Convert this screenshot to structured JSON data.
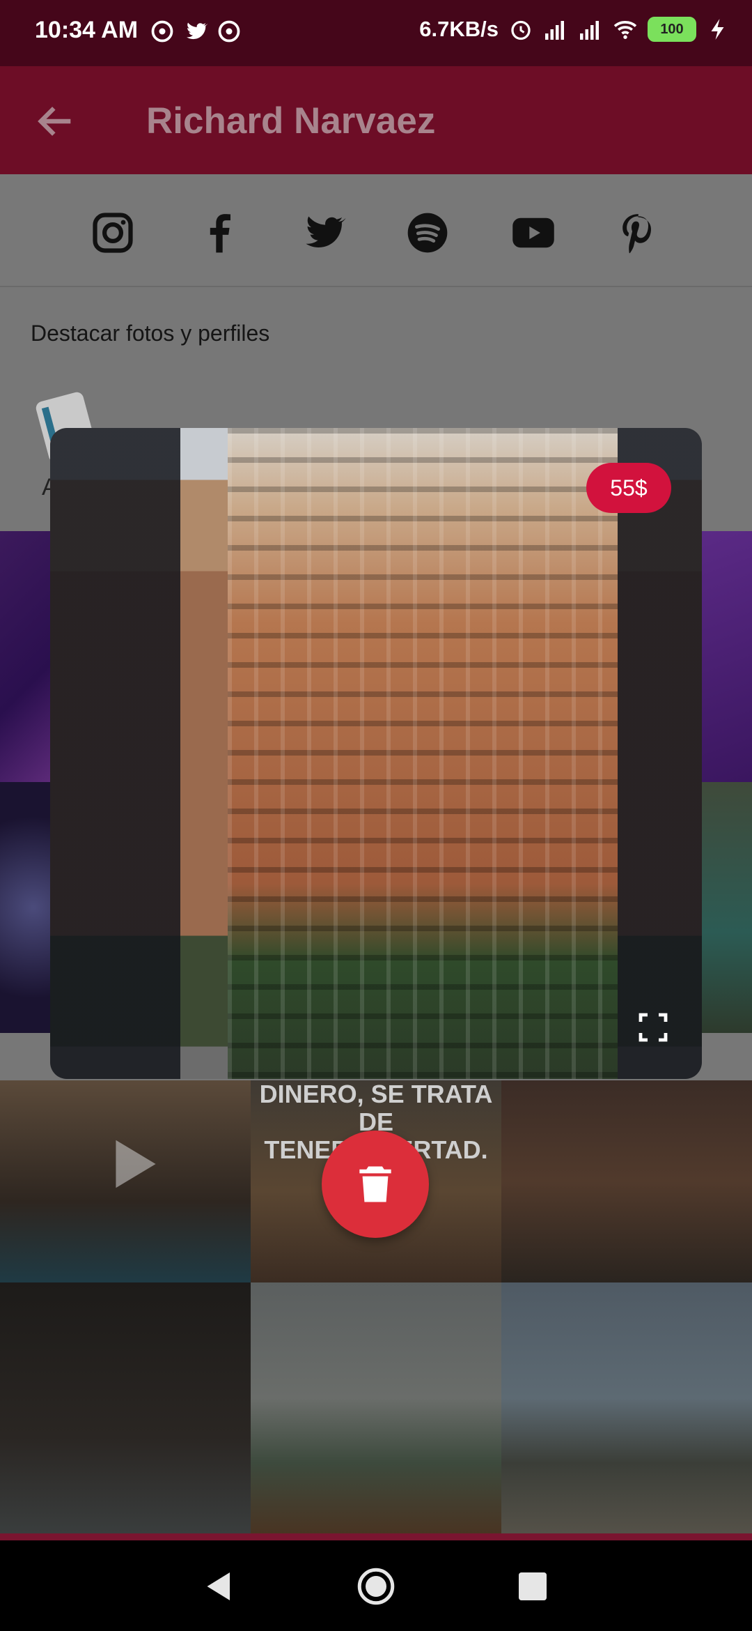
{
  "status_bar": {
    "time": "10:34 AM",
    "speed": "6.7KB/s",
    "battery": "100",
    "icons": [
      "sync-icon",
      "twitter-icon",
      "sync-icon",
      "alarm-icon",
      "signal-icon",
      "signal-icon",
      "wifi-icon",
      "battery-icon",
      "charging-icon"
    ]
  },
  "app_bar": {
    "title": "Richard Narvaez",
    "back_icon": "back-arrow-icon"
  },
  "social": {
    "icons": [
      "instagram-icon",
      "facebook-icon",
      "twitter-icon",
      "spotify-icon",
      "youtube-icon",
      "pinterest-icon"
    ]
  },
  "section": {
    "label": "Destacar fotos y perfiles",
    "hidden_text": "A"
  },
  "grid": {
    "quote_lines": [
      "DINERO, SE TRATA DE",
      "TENER LIBERTAD."
    ]
  },
  "card": {
    "price": "55$",
    "fullscreen_icon": "fullscreen-icon"
  },
  "fab": {
    "icon": "trash-icon"
  },
  "nav": {
    "buttons": [
      "back-triangle-icon",
      "home-circle-icon",
      "recents-square-icon"
    ]
  },
  "colors": {
    "status_bar": "#45061a",
    "app_bar": "#6d0d26",
    "price_badge": "#d2123d",
    "delete_fab": "#dc2e3a"
  }
}
